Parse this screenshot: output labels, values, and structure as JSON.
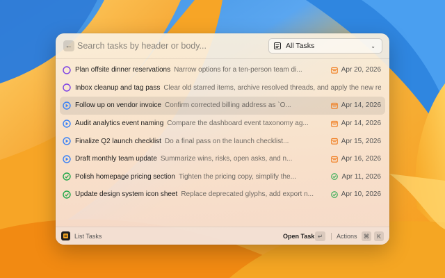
{
  "search": {
    "placeholder": "Search tasks by header or body..."
  },
  "filter": {
    "selected": "All Tasks",
    "icon": "list-icon"
  },
  "colors": {
    "todo": "#7b3fe4",
    "in_progress": "#3b82f6",
    "done": "#22a84a",
    "due": "#f07a1a"
  },
  "tasks": [
    {
      "title": "Plan offsite dinner reservations",
      "body": "Narrow options for a ten-person team di...",
      "status": "todo",
      "date": "Apr 20, 2026",
      "date_icon": "calendar-icon"
    },
    {
      "title": "Inbox cleanup and tag pass",
      "body": "Clear old starred items, archive resolved threads, and apply the new re...",
      "status": "todo",
      "date": "",
      "date_icon": ""
    },
    {
      "title": "Follow up on vendor invoice",
      "body": "Confirm corrected billing address as `O...",
      "status": "in_progress",
      "date": "Apr 14, 2026",
      "date_icon": "calendar-icon"
    },
    {
      "title": "Audit analytics event naming",
      "body": "Compare the dashboard event taxonomy ag...",
      "status": "in_progress",
      "date": "Apr 14, 2026",
      "date_icon": "calendar-icon"
    },
    {
      "title": "Finalize Q2 launch checklist",
      "body": "Do a final pass on the launch checklist...",
      "status": "in_progress",
      "date": "Apr 15, 2026",
      "date_icon": "calendar-icon"
    },
    {
      "title": "Draft monthly team update",
      "body": "Summarize wins, risks, open asks, and n...",
      "status": "in_progress",
      "date": "Apr 16, 2026",
      "date_icon": "calendar-icon"
    },
    {
      "title": "Polish homepage pricing section",
      "body": "Tighten the pricing copy, simplify the...",
      "status": "done",
      "date": "Apr 11, 2026",
      "date_icon": "check-circle-icon"
    },
    {
      "title": "Update design system icon sheet",
      "body": "Replace deprecated glyphs, add export n...",
      "status": "done",
      "date": "Apr 10, 2026",
      "date_icon": "check-circle-icon"
    }
  ],
  "selected_index": 2,
  "footer": {
    "title": "List Tasks",
    "primary_action": "Open Task",
    "primary_key": "↵",
    "secondary_action": "Actions",
    "secondary_keys": [
      "⌘",
      "K"
    ]
  }
}
